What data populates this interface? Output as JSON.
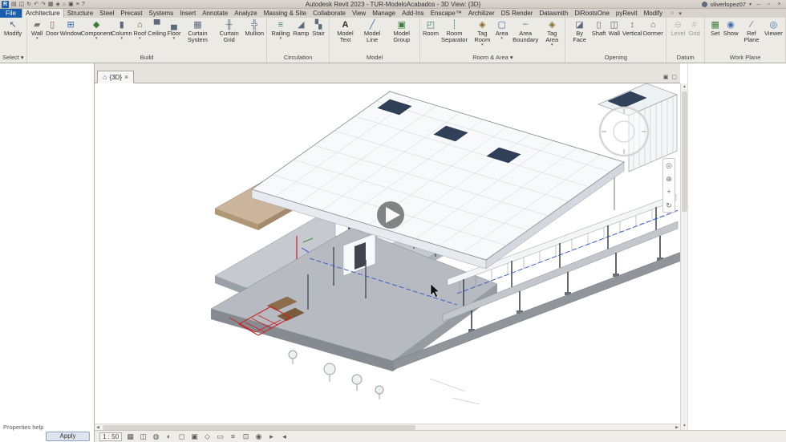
{
  "colors": {
    "file_button": "#1a5dad",
    "play_overlay": "#222222",
    "level_line_blue": "#2f55cc",
    "stair_red": "#cc2222",
    "skylight": "#2f4058"
  },
  "titlebar": {
    "logo": "R",
    "title": "Autodesk Revit 2023 - TUR-ModeloAcabados - 3D View: {3D}",
    "user": "oliverlopez07",
    "user_caret": "▾",
    "qat": [
      "▤",
      "◫",
      "↻",
      "↶",
      "↷",
      "▦",
      "◈",
      "⌂",
      "▣",
      "≡",
      "?"
    ],
    "win": [
      "–",
      "▫",
      "×"
    ]
  },
  "tabrow": {
    "file": "File",
    "tabs": [
      "Architecture",
      "Structure",
      "Steel",
      "Precast",
      "Systems",
      "Insert",
      "Annotate",
      "Analyze",
      "Massing & Site",
      "Collaborate",
      "View",
      "Manage",
      "Add-Ins",
      "Enscape™",
      "Archilizer",
      "DS Render",
      "Datasmith",
      "DiRootsOne",
      "pyRevit",
      "Modify"
    ],
    "extra": [
      "○",
      "▾"
    ]
  },
  "ribbon": {
    "panels": [
      {
        "label": "Select ▾",
        "tools": [
          {
            "label": "Modify",
            "icon": "↖"
          }
        ]
      },
      {
        "label": "Build",
        "tools": [
          {
            "label": "Wall",
            "icon": "▰",
            "caret": "▾"
          },
          {
            "label": "Door",
            "icon": "▯"
          },
          {
            "label": "Window",
            "icon": "⊞"
          },
          {
            "label": "Component",
            "icon": "◆",
            "caret": "▾"
          },
          {
            "label": "Column",
            "icon": "▮",
            "caret": "▾"
          },
          {
            "label": "Roof",
            "icon": "⌂",
            "caret": "▾"
          },
          {
            "label": "Ceiling",
            "icon": "▀"
          },
          {
            "label": "Floor",
            "icon": "▄",
            "caret": "▾"
          },
          {
            "label": "Curtain System",
            "icon": "▦"
          },
          {
            "label": "Curtain Grid",
            "icon": "╫"
          },
          {
            "label": "Mullion",
            "icon": "╬"
          }
        ]
      },
      {
        "label": "Circulation",
        "tools": [
          {
            "label": "Railing",
            "icon": "≡",
            "caret": "▾"
          },
          {
            "label": "Ramp",
            "icon": "◢"
          },
          {
            "label": "Stair",
            "icon": "▚"
          }
        ]
      },
      {
        "label": "Model",
        "tools": [
          {
            "label": "Model Text",
            "icon": "A"
          },
          {
            "label": "Model Line",
            "icon": "╱"
          },
          {
            "label": "Model Group",
            "icon": "▣"
          }
        ]
      },
      {
        "label": "Room & Area ▾",
        "tools": [
          {
            "label": "Room",
            "icon": "◰"
          },
          {
            "label": "Room Separator",
            "icon": "┊"
          },
          {
            "label": "Tag Room",
            "icon": "◈",
            "caret": "▾"
          },
          {
            "label": "Area",
            "icon": "▢",
            "caret": "▾"
          },
          {
            "label": "Area Boundary",
            "icon": "┄"
          },
          {
            "label": "Tag Area",
            "icon": "◈",
            "caret": "▾"
          }
        ]
      },
      {
        "label": "Opening",
        "tools": [
          {
            "label": "By Face",
            "icon": "◪"
          },
          {
            "label": "Shaft",
            "icon": "▯"
          },
          {
            "label": "Wall",
            "icon": "◫"
          },
          {
            "label": "Vertical",
            "icon": "↕"
          },
          {
            "label": "Dormer",
            "icon": "⌂"
          }
        ]
      },
      {
        "label": "Datum",
        "tools": [
          {
            "label": "Level",
            "icon": "⊖"
          },
          {
            "label": "Grid",
            "icon": "#"
          }
        ]
      },
      {
        "label": "Work Plane",
        "tools": [
          {
            "label": "Set",
            "icon": "▦"
          },
          {
            "label": "Show",
            "icon": "◉"
          },
          {
            "label": "Ref Plane",
            "icon": "∕"
          },
          {
            "label": "Viewer",
            "icon": "◎"
          }
        ]
      }
    ]
  },
  "viewtab": {
    "home_icon": "⌂",
    "label": "{3D}",
    "close": "×"
  },
  "viewstrip": {
    "right_icons": [
      "▣",
      "▢"
    ]
  },
  "navbar": {
    "icons": [
      "◎",
      "⊕",
      "+",
      "↻"
    ]
  },
  "scroll": {
    "up": "▲",
    "down": "▼",
    "left": "◀",
    "right": "▶"
  },
  "properties": {
    "help": "Properties help",
    "apply": "Apply"
  },
  "statusbar": {
    "scale": "1 : 50",
    "icons": [
      "▦",
      "◫",
      "◍",
      "◐",
      "◻",
      "▣",
      "◇",
      "▭",
      "≡",
      "⊡",
      "◉",
      "▸",
      "◂"
    ]
  }
}
